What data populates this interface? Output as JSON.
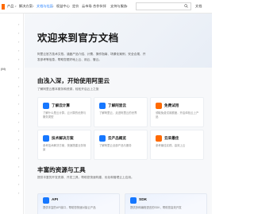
{
  "topnav": {
    "items": [
      {
        "label": "产品"
      },
      {
        "label": "解决方案"
      },
      {
        "label": "文档与社区"
      },
      {
        "label": "权益中心"
      },
      {
        "label": "定价"
      },
      {
        "label": "云市场"
      },
      {
        "label": "合作伙伴"
      },
      {
        "label": "支持与服务"
      }
    ],
    "search_placeholder": "",
    "right_label": "文档"
  },
  "sidebar": {
    "items": [
      {
        "label": ""
      },
      {
        "label": ""
      },
      {
        "label": ""
      },
      {
        "label": ""
      },
      {
        "label": ""
      },
      {
        "label": "(M)"
      },
      {
        "label": ""
      },
      {
        "label": ""
      },
      {
        "label": ""
      },
      {
        "label": ""
      },
      {
        "label": ""
      },
      {
        "label": ""
      },
      {
        "label": ""
      },
      {
        "label": ""
      },
      {
        "label": ""
      },
      {
        "label": ""
      },
      {
        "label": ""
      },
      {
        "label": ""
      },
      {
        "label": ""
      },
      {
        "label": ""
      }
    ]
  },
  "hero": {
    "title": "欢迎来到官方文档",
    "description": "阿里云官方技术文档，涵盖产品介绍、计费、操作指南、场景化案例、安全合规、开发参考等信息，帮助您更好地上云、用云、管云。"
  },
  "section_start": {
    "title": "由浅入深，开始使用阿里云",
    "description": "了解阿里云基本服务和资源，轻松开启云上之旅"
  },
  "start_cards": [
    {
      "title": "了解云计算",
      "description": "了解什么是云计算，云计算的优势与服务类型",
      "color": "#1677ff"
    },
    {
      "title": "了解阿里云",
      "description": "了解阿里云，走进阿里云的世界",
      "color": "#1677ff"
    },
    {
      "title": "免费试用",
      "description": "领取免费试用额度，开启体验云上产品",
      "color": "#ff6a00"
    },
    {
      "title": "技术解决方案",
      "description": "参考技术解决方案，快速搭建业务场景",
      "color": "#1677ff"
    },
    {
      "title": "云产品概览",
      "description": "了解阿里云全部产品与服务",
      "color": "#1677ff"
    },
    {
      "title": "云采最佳",
      "description": "参考最佳实践，高效上云",
      "color": "#ff6a00"
    }
  ],
  "section_resources": {
    "title": "丰富的资源与工具",
    "description": "提供丰富的开发资源、开发工具，帮助您快速构建、优化和管理云上应用。"
  },
  "resource_cards": [
    {
      "title": "API",
      "description": "提供丰富的API接口，帮助您快速对接云产品",
      "color": "#1677ff"
    },
    {
      "title": "SDK",
      "description": "提供多种编程语言的SDK，帮助您高效开发",
      "color": "#1677ff"
    }
  ]
}
